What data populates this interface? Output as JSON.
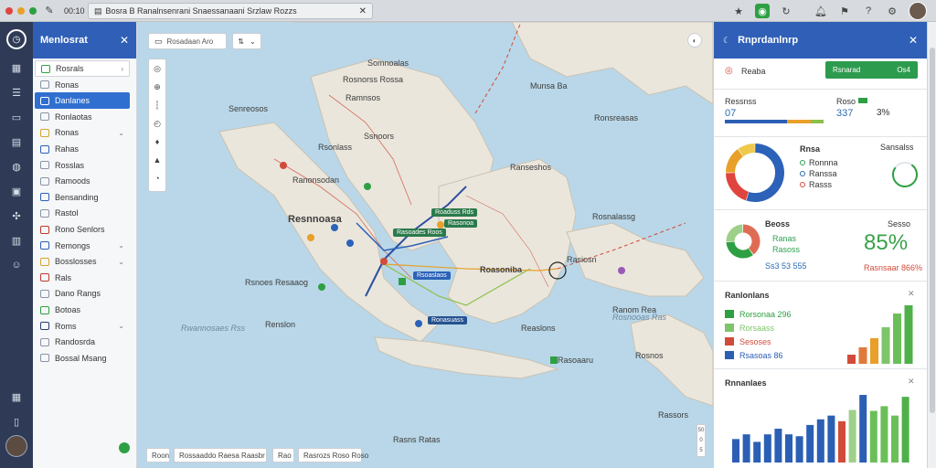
{
  "browser": {
    "time": "00:10",
    "url_text": "Bosra B Ranalnsenrani Snaessanaani Srzlaw Rozzs",
    "dot_colors": [
      "#e0443e",
      "#e8a02a",
      "#2ea043"
    ]
  },
  "sidebar": {
    "title": "Menlosrat",
    "items": [
      {
        "label": "Rosrals",
        "chev": "›",
        "color": "#2ea043"
      },
      {
        "label": "Ronas",
        "chev": "",
        "color": "#8a94a6"
      },
      {
        "label": "Danlanes",
        "chev": "",
        "color": "#c0392b"
      },
      {
        "label": "Ronlaotas",
        "chev": "",
        "color": "#8a94a6"
      },
      {
        "label": "Ronas",
        "chev": "⌄",
        "color": "#d4a72c"
      },
      {
        "label": "Rahas",
        "chev": "",
        "color": "#2c62b8"
      },
      {
        "label": "Rosslas",
        "chev": "",
        "color": "#8a94a6"
      },
      {
        "label": "Ramoods",
        "chev": "",
        "color": "#8a94a6"
      },
      {
        "label": "Bensanding",
        "chev": "",
        "color": "#2c62b8"
      },
      {
        "label": "Rastol",
        "chev": "",
        "color": "#8a94a6"
      },
      {
        "label": "Rono Senlors",
        "chev": "",
        "color": "#c0392b"
      },
      {
        "label": "Remongs",
        "chev": "⌄",
        "color": "#2c62b8"
      },
      {
        "label": "Bosslosses",
        "chev": "⌄",
        "color": "#d4a72c"
      },
      {
        "label": "Rals",
        "chev": "",
        "color": "#c0392b"
      },
      {
        "label": "Dano Rangs",
        "chev": "",
        "color": "#8a94a6"
      },
      {
        "label": "Botoas",
        "chev": "",
        "color": "#2ea043"
      },
      {
        "label": "Roms",
        "chev": "⌄",
        "color": "#2c3e70"
      },
      {
        "label": "Randosrda",
        "chev": "",
        "color": "#8a94a6"
      },
      {
        "label": "Bossal Msang",
        "chev": "",
        "color": "#8a94a6"
      }
    ]
  },
  "map": {
    "search_text": "Rosadaan Aro",
    "dropdown_text": "⌄",
    "bottom_left": "Roon",
    "bottom_mid": "Rossaaddo Raesa Raasbr",
    "bottom_right_a": "Rao",
    "bottom_right_b": "Rasrozs Roso Roso",
    "labels": {
      "l1": "Senreosos",
      "l2": "Rosnorss Rossa",
      "l3": "Somnoalas",
      "l4": "Ssnoors",
      "l5": "Rsonlass",
      "l6": "Ranonsodan",
      "l7": "Resnnoasa",
      "l8": "Rsnoes Resaaog",
      "l9": "Ranseshos",
      "l10": "Munsa Ba",
      "l11": "Ronsreasas",
      "l12": "Rosnalassg",
      "l13": "Roasoniba",
      "l14": "Rasiosn",
      "l15": "Renslon",
      "l16": "Reaslons",
      "l17": "Rasoaaru",
      "l18": "Rosnos",
      "l19": "Rassors",
      "l20": "Ranom Rea",
      "l21": "Ramnsos",
      "l22": "Rasns Ratas",
      "sea1": "Rwannosaes Rss",
      "sea2": "Rosnooas Ras"
    },
    "tags": {
      "t1": "Roaduss Rds",
      "t2": "Rasonoa",
      "t3": "Rasoades Roos",
      "t4": "Rsoaslaos",
      "t5": "Ronasuass"
    },
    "scale": [
      "50",
      "0",
      "5"
    ]
  },
  "panel": {
    "title": "Rnprdanlnrp",
    "row1_label": "Reaba",
    "row1_button": "Rsnarad",
    "row1_button_value": "Os4",
    "stat1_label": "Ressnss",
    "stat1_value": "07",
    "stat2_label": "Roso",
    "stat2_value": "337",
    "stat3_value": "3%",
    "donut_title": "Rnsa",
    "donut_legend": [
      {
        "label": "Ronnna",
        "color": "#2e9f52"
      },
      {
        "label": "Ranssa",
        "color": "#2b6cb0"
      },
      {
        "label": "Rasss",
        "color": "#d24b3a"
      }
    ],
    "gauge_title": "Sansalss",
    "donut_values": [
      55,
      20,
      15,
      10
    ],
    "donut_colors": [
      "#2c62b8",
      "#e0443e",
      "#e8a02a",
      "#f0c94a"
    ],
    "gauge_fraction": 0.82,
    "pie_title": "Beoss",
    "pie_lines": [
      "Ranas",
      "Rasoss"
    ],
    "pie_caption": "Ss3 53 555",
    "pie_values": [
      40,
      35,
      25
    ],
    "pie_colors": [
      "#e06b55",
      "#2ea043",
      "#9fd08a"
    ],
    "pct_value": "85%",
    "pct_caption": "Rasnsaar 866%",
    "legend_title": "Ranlonlans",
    "legend_items": [
      {
        "label": "Rorsonaa 296",
        "color": "#2ea043"
      },
      {
        "label": "Rorsaass",
        "color": "#7ec46a"
      },
      {
        "label": "Sesoses",
        "color": "#d24b3a"
      },
      {
        "label": "Rsasoas 86",
        "color": "#2b5fb4"
      }
    ],
    "bars1": [
      {
        "value": 10,
        "color": "#d24b3a"
      },
      {
        "value": 18,
        "color": "#e07a3a"
      },
      {
        "value": 28,
        "color": "#e8a02a"
      },
      {
        "value": 40,
        "color": "#7ec46a"
      },
      {
        "value": 55,
        "color": "#6bbf59"
      },
      {
        "value": 64,
        "color": "#4fb04a"
      }
    ],
    "bars_title": "Rnnanlaes",
    "bars2": [
      {
        "value": 25,
        "color": "#2b5fb4"
      },
      {
        "value": 30,
        "color": "#2b5fb4"
      },
      {
        "value": 22,
        "color": "#2b5fb4"
      },
      {
        "value": 30,
        "color": "#2b5fb4"
      },
      {
        "value": 36,
        "color": "#2b5fb4"
      },
      {
        "value": 30,
        "color": "#2b5fb4"
      },
      {
        "value": 28,
        "color": "#2b5fb4"
      },
      {
        "value": 40,
        "color": "#2b5fb4"
      },
      {
        "value": 46,
        "color": "#2b5fb4"
      },
      {
        "value": 50,
        "color": "#2b5fb4"
      },
      {
        "value": 44,
        "color": "#d24b3a"
      },
      {
        "value": 56,
        "color": "#9fd08a"
      },
      {
        "value": 72,
        "color": "#2b5fb4"
      },
      {
        "value": 55,
        "color": "#6bbf59"
      },
      {
        "value": 60,
        "color": "#6bbf59"
      },
      {
        "value": 50,
        "color": "#6bbf59"
      },
      {
        "value": 70,
        "color": "#4fb04a"
      }
    ]
  }
}
